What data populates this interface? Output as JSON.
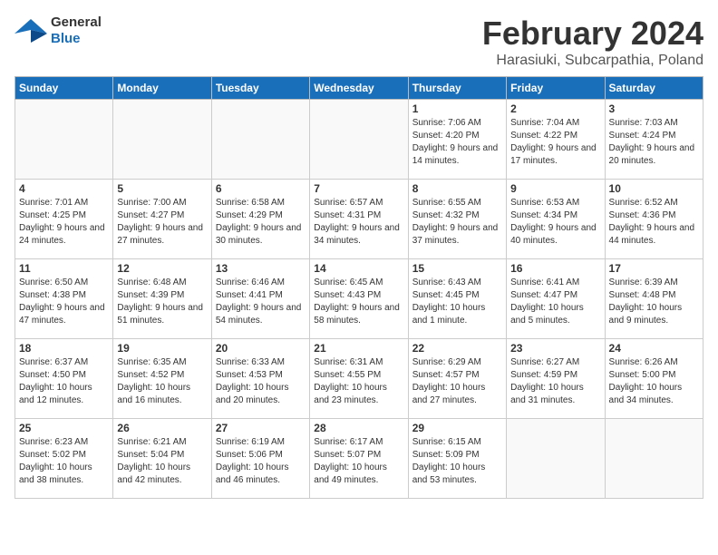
{
  "header": {
    "logo_general": "General",
    "logo_blue": "Blue",
    "title": "February 2024",
    "subtitle": "Harasiuki, Subcarpathia, Poland"
  },
  "weekdays": [
    "Sunday",
    "Monday",
    "Tuesday",
    "Wednesday",
    "Thursday",
    "Friday",
    "Saturday"
  ],
  "weeks": [
    [
      {
        "day": "",
        "sunrise": "",
        "sunset": "",
        "daylight": ""
      },
      {
        "day": "",
        "sunrise": "",
        "sunset": "",
        "daylight": ""
      },
      {
        "day": "",
        "sunrise": "",
        "sunset": "",
        "daylight": ""
      },
      {
        "day": "",
        "sunrise": "",
        "sunset": "",
        "daylight": ""
      },
      {
        "day": "1",
        "sunrise": "Sunrise: 7:06 AM",
        "sunset": "Sunset: 4:20 PM",
        "daylight": "Daylight: 9 hours and 14 minutes."
      },
      {
        "day": "2",
        "sunrise": "Sunrise: 7:04 AM",
        "sunset": "Sunset: 4:22 PM",
        "daylight": "Daylight: 9 hours and 17 minutes."
      },
      {
        "day": "3",
        "sunrise": "Sunrise: 7:03 AM",
        "sunset": "Sunset: 4:24 PM",
        "daylight": "Daylight: 9 hours and 20 minutes."
      }
    ],
    [
      {
        "day": "4",
        "sunrise": "Sunrise: 7:01 AM",
        "sunset": "Sunset: 4:25 PM",
        "daylight": "Daylight: 9 hours and 24 minutes."
      },
      {
        "day": "5",
        "sunrise": "Sunrise: 7:00 AM",
        "sunset": "Sunset: 4:27 PM",
        "daylight": "Daylight: 9 hours and 27 minutes."
      },
      {
        "day": "6",
        "sunrise": "Sunrise: 6:58 AM",
        "sunset": "Sunset: 4:29 PM",
        "daylight": "Daylight: 9 hours and 30 minutes."
      },
      {
        "day": "7",
        "sunrise": "Sunrise: 6:57 AM",
        "sunset": "Sunset: 4:31 PM",
        "daylight": "Daylight: 9 hours and 34 minutes."
      },
      {
        "day": "8",
        "sunrise": "Sunrise: 6:55 AM",
        "sunset": "Sunset: 4:32 PM",
        "daylight": "Daylight: 9 hours and 37 minutes."
      },
      {
        "day": "9",
        "sunrise": "Sunrise: 6:53 AM",
        "sunset": "Sunset: 4:34 PM",
        "daylight": "Daylight: 9 hours and 40 minutes."
      },
      {
        "day": "10",
        "sunrise": "Sunrise: 6:52 AM",
        "sunset": "Sunset: 4:36 PM",
        "daylight": "Daylight: 9 hours and 44 minutes."
      }
    ],
    [
      {
        "day": "11",
        "sunrise": "Sunrise: 6:50 AM",
        "sunset": "Sunset: 4:38 PM",
        "daylight": "Daylight: 9 hours and 47 minutes."
      },
      {
        "day": "12",
        "sunrise": "Sunrise: 6:48 AM",
        "sunset": "Sunset: 4:39 PM",
        "daylight": "Daylight: 9 hours and 51 minutes."
      },
      {
        "day": "13",
        "sunrise": "Sunrise: 6:46 AM",
        "sunset": "Sunset: 4:41 PM",
        "daylight": "Daylight: 9 hours and 54 minutes."
      },
      {
        "day": "14",
        "sunrise": "Sunrise: 6:45 AM",
        "sunset": "Sunset: 4:43 PM",
        "daylight": "Daylight: 9 hours and 58 minutes."
      },
      {
        "day": "15",
        "sunrise": "Sunrise: 6:43 AM",
        "sunset": "Sunset: 4:45 PM",
        "daylight": "Daylight: 10 hours and 1 minute."
      },
      {
        "day": "16",
        "sunrise": "Sunrise: 6:41 AM",
        "sunset": "Sunset: 4:47 PM",
        "daylight": "Daylight: 10 hours and 5 minutes."
      },
      {
        "day": "17",
        "sunrise": "Sunrise: 6:39 AM",
        "sunset": "Sunset: 4:48 PM",
        "daylight": "Daylight: 10 hours and 9 minutes."
      }
    ],
    [
      {
        "day": "18",
        "sunrise": "Sunrise: 6:37 AM",
        "sunset": "Sunset: 4:50 PM",
        "daylight": "Daylight: 10 hours and 12 minutes."
      },
      {
        "day": "19",
        "sunrise": "Sunrise: 6:35 AM",
        "sunset": "Sunset: 4:52 PM",
        "daylight": "Daylight: 10 hours and 16 minutes."
      },
      {
        "day": "20",
        "sunrise": "Sunrise: 6:33 AM",
        "sunset": "Sunset: 4:53 PM",
        "daylight": "Daylight: 10 hours and 20 minutes."
      },
      {
        "day": "21",
        "sunrise": "Sunrise: 6:31 AM",
        "sunset": "Sunset: 4:55 PM",
        "daylight": "Daylight: 10 hours and 23 minutes."
      },
      {
        "day": "22",
        "sunrise": "Sunrise: 6:29 AM",
        "sunset": "Sunset: 4:57 PM",
        "daylight": "Daylight: 10 hours and 27 minutes."
      },
      {
        "day": "23",
        "sunrise": "Sunrise: 6:27 AM",
        "sunset": "Sunset: 4:59 PM",
        "daylight": "Daylight: 10 hours and 31 minutes."
      },
      {
        "day": "24",
        "sunrise": "Sunrise: 6:26 AM",
        "sunset": "Sunset: 5:00 PM",
        "daylight": "Daylight: 10 hours and 34 minutes."
      }
    ],
    [
      {
        "day": "25",
        "sunrise": "Sunrise: 6:23 AM",
        "sunset": "Sunset: 5:02 PM",
        "daylight": "Daylight: 10 hours and 38 minutes."
      },
      {
        "day": "26",
        "sunrise": "Sunrise: 6:21 AM",
        "sunset": "Sunset: 5:04 PM",
        "daylight": "Daylight: 10 hours and 42 minutes."
      },
      {
        "day": "27",
        "sunrise": "Sunrise: 6:19 AM",
        "sunset": "Sunset: 5:06 PM",
        "daylight": "Daylight: 10 hours and 46 minutes."
      },
      {
        "day": "28",
        "sunrise": "Sunrise: 6:17 AM",
        "sunset": "Sunset: 5:07 PM",
        "daylight": "Daylight: 10 hours and 49 minutes."
      },
      {
        "day": "29",
        "sunrise": "Sunrise: 6:15 AM",
        "sunset": "Sunset: 5:09 PM",
        "daylight": "Daylight: 10 hours and 53 minutes."
      },
      {
        "day": "",
        "sunrise": "",
        "sunset": "",
        "daylight": ""
      },
      {
        "day": "",
        "sunrise": "",
        "sunset": "",
        "daylight": ""
      }
    ]
  ]
}
